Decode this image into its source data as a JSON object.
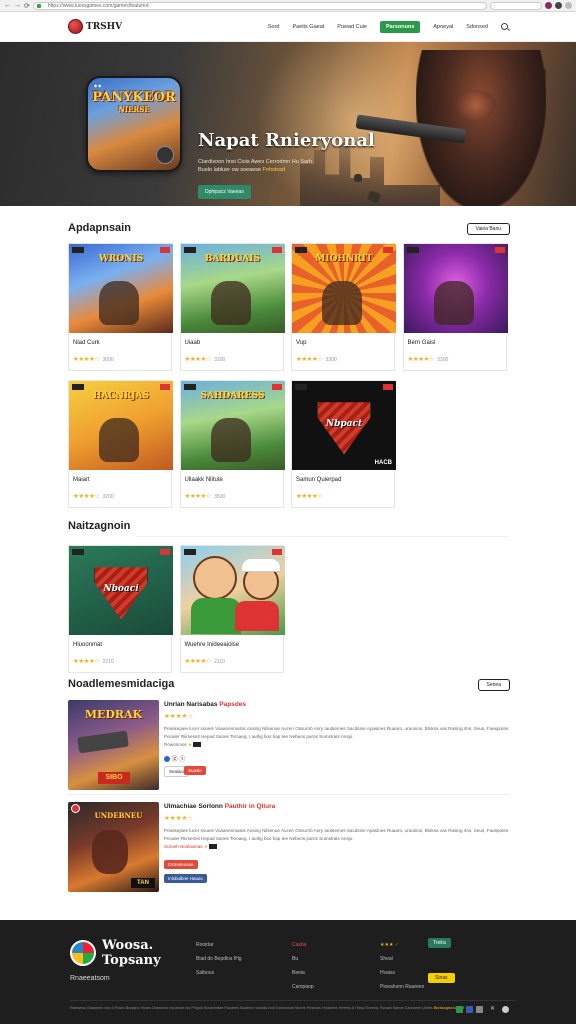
{
  "browser": {
    "url": "https://www.lucesgames.com/games/featured",
    "nav_back": "←",
    "nav_forward": "→",
    "nav_reload": "⟳",
    "tab_title": "Isse"
  },
  "header": {
    "brand": "TRSHV",
    "menu": [
      "Sord",
      "Paetis Gaeat",
      "Puwad Cuie"
    ],
    "cta": "Parsonuns",
    "menu_right": [
      "Apoeyal",
      "Sdonsed"
    ]
  },
  "hero": {
    "icon_title": "PANYKEOR",
    "icon_subtitle": "NIERSE",
    "title": "Napat Rnieryonal",
    "subtitle_line1": "Ciardisoon hnsi Ciois Awes Cerrodmn Hu Sarh",
    "subtitle_line2": "Buelo labluer ow soeaese",
    "subtitle_highlight": "Fnhstsad",
    "button": "Dphipacs Vaeeas"
  },
  "section1": {
    "title": "Apdapnsain",
    "button": "Vaiea Banu",
    "cards": [
      {
        "name": "Nlad Curk",
        "rating": "★★★★☆",
        "count": "3000",
        "label": "WRONIS",
        "theme": "blue"
      },
      {
        "name": "Uiaab",
        "rating": "★★★★☆",
        "count": "3300",
        "label": "BARDUAIS",
        "theme": "green"
      },
      {
        "name": "Vup",
        "rating": "★★★★☆",
        "count": "3300",
        "label": "MIOHNRIT",
        "theme": "sun"
      },
      {
        "name": "Bern Gaisl",
        "rating": "★★★★☆",
        "count": "3300",
        "label": "",
        "theme": "purple"
      },
      {
        "name": "Maiart",
        "rating": "★★★★☆",
        "count": "3200",
        "label": "HACNRJAS",
        "theme": "yellow"
      },
      {
        "name": "Ullaakk Nlitute",
        "rating": "★★★★☆",
        "count": "3500",
        "label": "SAHDARESS",
        "theme": "green"
      },
      {
        "name": "Samun Quierpad",
        "rating": "★★★★☆",
        "count": "",
        "label": "Nbpact",
        "badge": "HACB",
        "theme": "shield-black"
      }
    ]
  },
  "section2": {
    "title": "Naitzagnoin",
    "cards": [
      {
        "name": "Hluoonmat",
        "rating": "★★★★☆",
        "count": "2210",
        "label": "Nboaci",
        "theme": "shield-green"
      },
      {
        "name": "Wuehre Inideeaiolse",
        "rating": "★★★★☆",
        "count": "2110",
        "label": "",
        "theme": "kids"
      }
    ]
  },
  "section3": {
    "title": "Noadlemesmidaciga",
    "button": "Senea",
    "items": [
      {
        "title": "Unrlan Narisabas",
        "title_accent": "Papsdes",
        "rating": "★★★★☆",
        "desc": "Peaskepiee lucer soueis Voaanenmatos Aosing Nilsenue Aucen Ossurnb Anry Iautsemes Sacdsine Apasines Ruaaro, uraoinos, Bloksa vas Rasing 4ns, Seus, Faaspotes Pecaler Riirsesnit Hepad Sanes Tsroaeg, I aurlig bos hap tee Nebeos paros Sumstrats Ansjo.",
        "meta": "Rowonnios",
        "btn1": "Sealaio",
        "btn2": "Suasle",
        "thumb_label": "MEDRAK",
        "thumb_badge": "SIBO"
      },
      {
        "title": "Ulmachiae Sorlonn",
        "title_accent": "Pauthir in Qliura",
        "rating": "★★★★☆",
        "desc": "Peaskepiee lucer soueis Voaanenmatos Aosing Nilsenue Aucen Ossurnb Anry Iautsemes Sacdsine Apasines Ruaaro, uraoinos, Bloksa vas Rasing 4ns, Seus, Faaspotes Pecaler Riirsesnit Hepad Sanes Tsroaeg, I aurlig bos hap tee Nebeos paros Sumstrats Ansjo.",
        "meta": "Suroeh Noslawnas",
        "btn1": "Osmeteusaa",
        "btn2": "Inlsbulbne Hauas",
        "thumb_label": "UNDEBNEU",
        "thumb_badge": "TAN"
      }
    ]
  },
  "footer": {
    "brand_line1": "Woosa.",
    "brand_line2": "Topsany",
    "url": "Rnaeeatsom",
    "col1": [
      "Rooidar",
      "Biad do Bepdlos fHg",
      "Salbous"
    ],
    "col2": [
      "Casba",
      "Bu",
      "Beeia",
      "Campaop"
    ],
    "col3": [
      "Sheal",
      "Hvaiss",
      "Pioeahonn Raarees"
    ],
    "col3_rating": "★★★",
    "badge_green": "Trelra",
    "badge_yellow": "Sinas",
    "copyright": "Raeswoo Gdausmo ean 4 Ruwa Bonjano Vuses Drawnvin rnuonroe ios Pinpos Sovanhrtae Faodees Baatrue rounlda Anti Garsnosse Moree Reainos Hodwens Heerns 8 Hlrsa Sovena, Ruvais Saeos Caunamn Ustles",
    "copyright_accent": "Bnrasogea tuvim t"
  },
  "colors": {
    "accent_green": "#2a9a4a",
    "star": "#f2b01e",
    "footer_bg": "#1e1e1e",
    "alert_red": "#d33"
  }
}
